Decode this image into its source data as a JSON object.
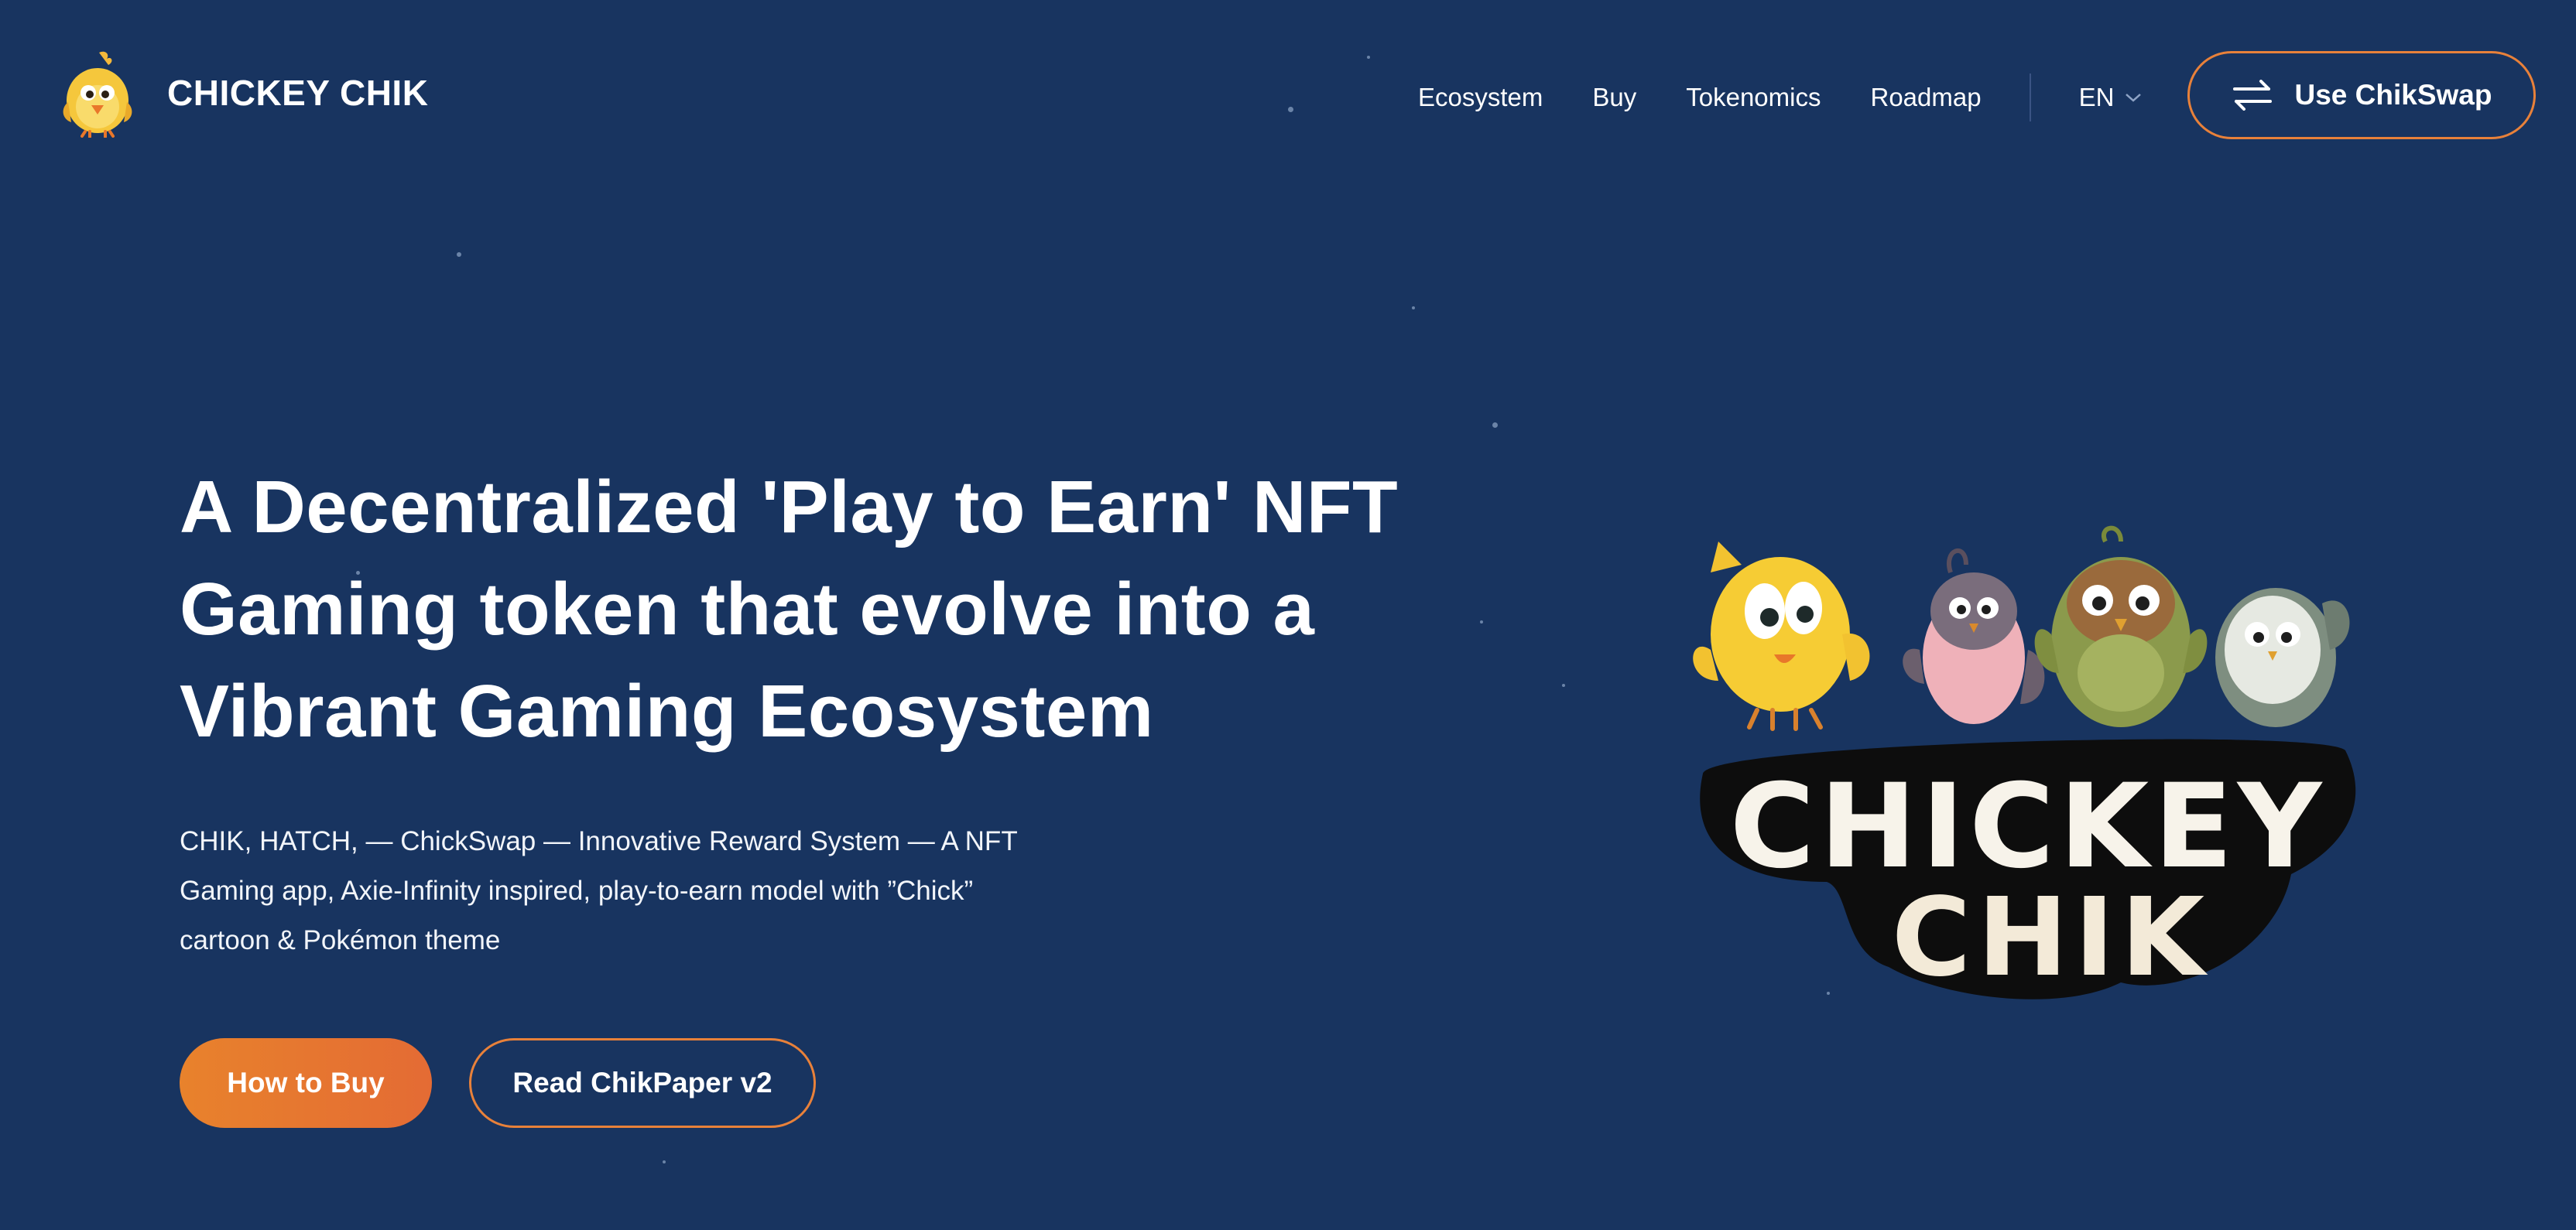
{
  "header": {
    "brand_name": "CHICKEY CHIK",
    "nav": [
      "Ecosystem",
      "Buy",
      "Tokenomics",
      "Roadmap"
    ],
    "language": "EN",
    "swap_button": "Use ChikSwap"
  },
  "hero": {
    "title": "A Decentralized 'Play to Earn' NFT Gaming token that evolve into a Vibrant Gaming Ecosystem",
    "description": "CHIK, HATCH, — ChickSwap — Innovative Reward System — A NFT Gaming app, Axie-Infinity inspired, play-to-earn model with ”Chick” cartoon & Pokémon theme",
    "primary_button": "How to Buy",
    "secondary_button": "Read ChikPaper v2",
    "art_logo": [
      "CHICKEY",
      "CHIK"
    ]
  },
  "colors": {
    "background": "#183460",
    "accent": "#e8813a"
  },
  "icons": [
    "chick-logo-icon",
    "chevron-down-icon",
    "swap-arrows-icon"
  ]
}
